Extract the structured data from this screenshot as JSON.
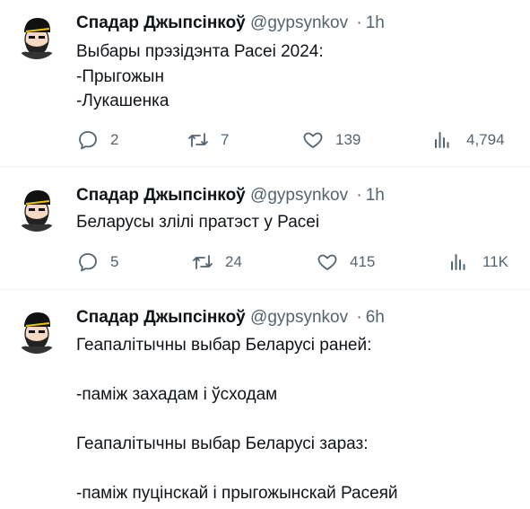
{
  "colors": {
    "text_primary": "#0f1419",
    "text_secondary": "#536471",
    "divider": "#eff3f4",
    "background": "#ffffff"
  },
  "icons": {
    "reply": "reply-icon",
    "retweet": "retweet-icon",
    "like": "like-icon",
    "views": "views-icon"
  },
  "tweets": [
    {
      "author": "Спадар Джыпсінкоў",
      "handle": "@gypsynkov",
      "separator": "·",
      "time": "1h",
      "text": "Выбары прэзідэнта Расеі 2024:\n-Прыгожын\n-Лукашенка",
      "replies": "2",
      "retweets": "7",
      "likes": "139",
      "views": "4,794"
    },
    {
      "author": "Спадар Джыпсінкоў",
      "handle": "@gypsynkov",
      "separator": "·",
      "time": "1h",
      "text": "Беларусы злілі пратэст у Расеі",
      "replies": "5",
      "retweets": "24",
      "likes": "415",
      "views": "11K"
    },
    {
      "author": "Спадар Джыпсінкоў",
      "handle": "@gypsynkov",
      "separator": "·",
      "time": "6h",
      "text": "Геапалітычны выбар Беларусі раней:\n\n-паміж захадам і ўсходам\n\nГеапалітычны выбар Беларусі зараз:\n\n-паміж пуцінскай і прыгожынскай Расеяй"
    }
  ]
}
